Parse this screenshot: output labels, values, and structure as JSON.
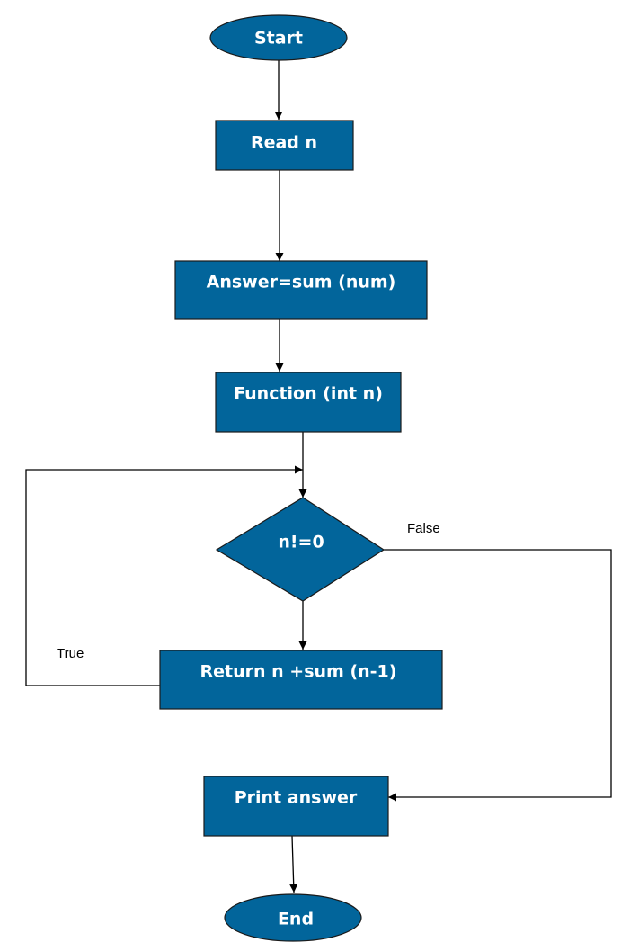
{
  "diagram": {
    "type": "flowchart",
    "colors": {
      "node_fill": "#02659b",
      "node_text": "#ffffff",
      "edge": "#000000"
    },
    "nodes": {
      "start": {
        "shape": "ellipse",
        "label": "Start"
      },
      "read_n": {
        "shape": "rectangle",
        "label": "Read n"
      },
      "answer": {
        "shape": "rectangle",
        "label": "Answer=sum (num)"
      },
      "function": {
        "shape": "rectangle",
        "label": "Function (int n)"
      },
      "decision": {
        "shape": "diamond",
        "label": "n!=0"
      },
      "return": {
        "shape": "rectangle",
        "label": "Return n +sum (n-1)"
      },
      "print": {
        "shape": "rectangle",
        "label": "Print answer"
      },
      "end": {
        "shape": "ellipse",
        "label": "End"
      }
    },
    "edges": [
      {
        "from": "start",
        "to": "read_n",
        "label": ""
      },
      {
        "from": "read_n",
        "to": "answer",
        "label": ""
      },
      {
        "from": "answer",
        "to": "function",
        "label": ""
      },
      {
        "from": "function",
        "to": "decision",
        "label": ""
      },
      {
        "from": "decision",
        "to": "return",
        "label": ""
      },
      {
        "from": "return",
        "to": "decision",
        "label": "True"
      },
      {
        "from": "decision",
        "to": "print",
        "label": "False"
      },
      {
        "from": "print",
        "to": "end",
        "label": ""
      }
    ],
    "edge_labels": {
      "true": "True",
      "false": "False"
    }
  }
}
